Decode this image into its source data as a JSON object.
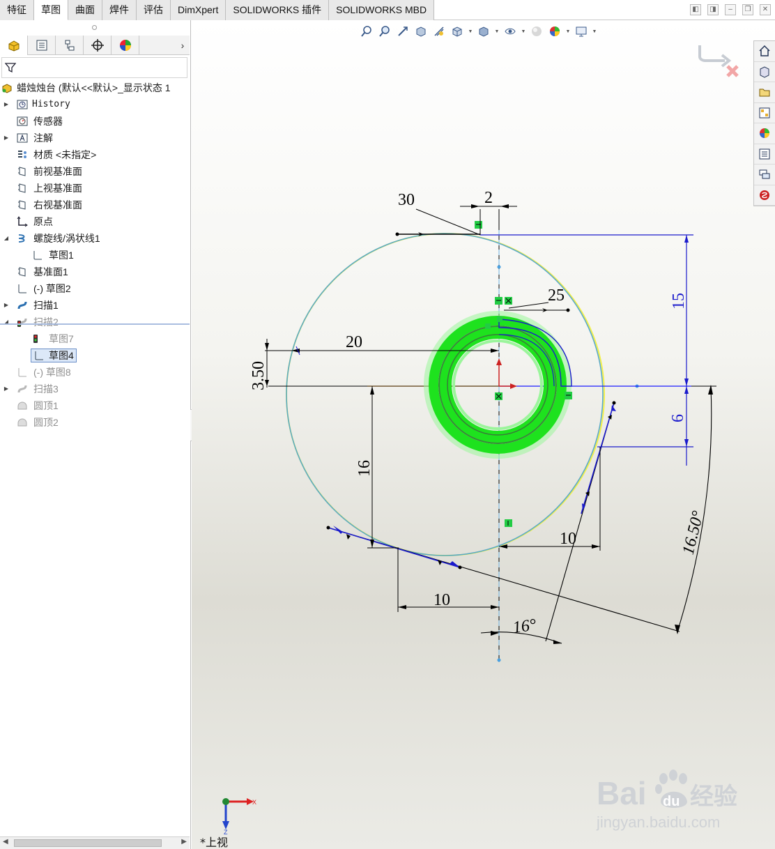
{
  "tabs": [
    "特征",
    "草图",
    "曲面",
    "焊件",
    "评估",
    "DimXpert",
    "SOLIDWORKS 插件",
    "SOLIDWORKS MBD"
  ],
  "active_tab": "草图",
  "tree": {
    "root_label": "蜡烛烛台  (默认<<默认>_显示状态 1",
    "items": [
      {
        "label": "History",
        "icon": "history-icon"
      },
      {
        "label": "传感器",
        "icon": "sensor-icon"
      },
      {
        "label": "注解",
        "icon": "annotation-icon"
      },
      {
        "label": "材质 <未指定>",
        "icon": "material-icon"
      },
      {
        "label": "前视基准面",
        "icon": "plane-icon"
      },
      {
        "label": "上视基准面",
        "icon": "plane-icon"
      },
      {
        "label": "右视基准面",
        "icon": "plane-icon"
      },
      {
        "label": "原点",
        "icon": "origin-icon"
      },
      {
        "label": "螺旋线/涡状线1",
        "icon": "helix-icon"
      },
      {
        "label": "草图1",
        "icon": "sketch-icon"
      },
      {
        "label": "基准面1",
        "icon": "plane-icon"
      },
      {
        "label": "(-) 草图2",
        "icon": "sketch-icon"
      },
      {
        "label": "扫描1",
        "icon": "sweep-icon"
      },
      {
        "label": "扫描2",
        "icon": "sweep-icon"
      },
      {
        "label": "草图7",
        "icon": "sketch-icon"
      },
      {
        "label": "草图4",
        "icon": "sketch-icon"
      },
      {
        "label": "(-) 草图8",
        "icon": "sketch-icon"
      },
      {
        "label": "扫描3",
        "icon": "sweep-icon"
      },
      {
        "label": "圆顶1",
        "icon": "dome-icon"
      },
      {
        "label": "圆顶2",
        "icon": "dome-icon"
      }
    ]
  },
  "dimensions": {
    "d30": "30",
    "d2": "2",
    "d25": "25",
    "d15": "15",
    "d20": "20",
    "d3_50": "3.50",
    "d6": "6",
    "d16": "16",
    "d10a": "10",
    "d10b": "10",
    "d16_50": "16.50°",
    "d16deg": "16°"
  },
  "view": {
    "name": "*上视",
    "axis_x": "X",
    "axis_z": "Z"
  },
  "watermark": {
    "brand_main": "Bai",
    "brand_paw": "du",
    "brand_cn": "经验",
    "url": "jingyan.baidu.com"
  },
  "colors": {
    "sketch_line": "#0000cc",
    "circle": "#5aa9c9",
    "highlight": "#33ff33",
    "relation": "#22cc44",
    "dim": "#000000"
  }
}
